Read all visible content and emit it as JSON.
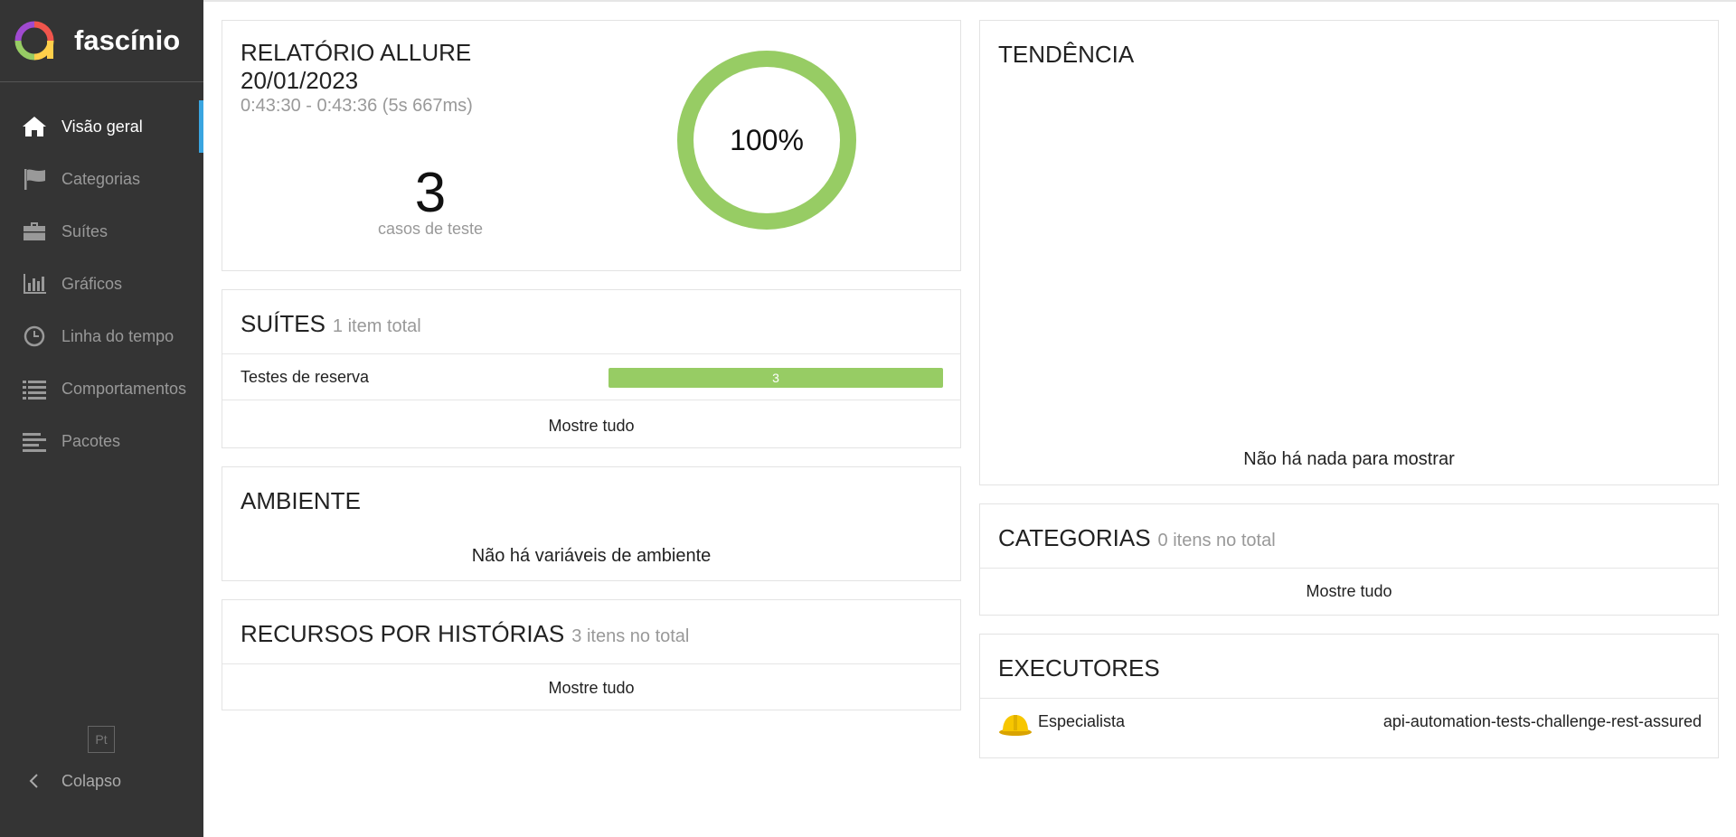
{
  "brand": {
    "name": "fascínio"
  },
  "sidebar": {
    "items": [
      {
        "label": "Visão geral",
        "icon": "home-icon",
        "active": true
      },
      {
        "label": "Categorias",
        "icon": "flag-icon",
        "active": false
      },
      {
        "label": "Suítes",
        "icon": "briefcase-icon",
        "active": false
      },
      {
        "label": "Gráficos",
        "icon": "bar-chart-icon",
        "active": false
      },
      {
        "label": "Linha do tempo",
        "icon": "clock-icon",
        "active": false
      },
      {
        "label": "Comportamentos",
        "icon": "list-icon",
        "active": false
      },
      {
        "label": "Pacotes",
        "icon": "align-left-icon",
        "active": false
      }
    ],
    "language": "Pt",
    "collapse_label": "Colapso"
  },
  "summary": {
    "title_line1": "RELATÓRIO ALLURE",
    "title_line2": "20/01/2023",
    "time": "0:43:30 - 0:43:36 (5s 667ms)",
    "count": "3",
    "count_label": "casos de teste",
    "percent_text": "100%",
    "pass_fraction": 1.0,
    "pass_color": "#97cc64"
  },
  "suites": {
    "title": "SUÍTES",
    "subtitle": "1 item total",
    "rows": [
      {
        "name": "Testes de reserva",
        "passed": "3"
      }
    ],
    "show_all": "Mostre tudo"
  },
  "environment": {
    "title": "AMBIENTE",
    "empty": "Não há variáveis de ambiente"
  },
  "features": {
    "title": "RECURSOS POR HISTÓRIAS",
    "subtitle": "3 itens no total",
    "show_all": "Mostre tudo"
  },
  "trend": {
    "title": "TENDÊNCIA",
    "empty": "Não há nada para mostrar"
  },
  "categories": {
    "title": "CATEGORIAS",
    "subtitle": "0 itens no total",
    "show_all": "Mostre tudo"
  },
  "executors": {
    "title": "EXECUTORES",
    "name": "Especialista",
    "build": "api-automation-tests-challenge-rest-assured",
    "icon": "hard-hat-icon"
  },
  "colors": {
    "sidebar_bg": "#343434",
    "accent": "#3aa5e0",
    "passed": "#97cc64"
  }
}
